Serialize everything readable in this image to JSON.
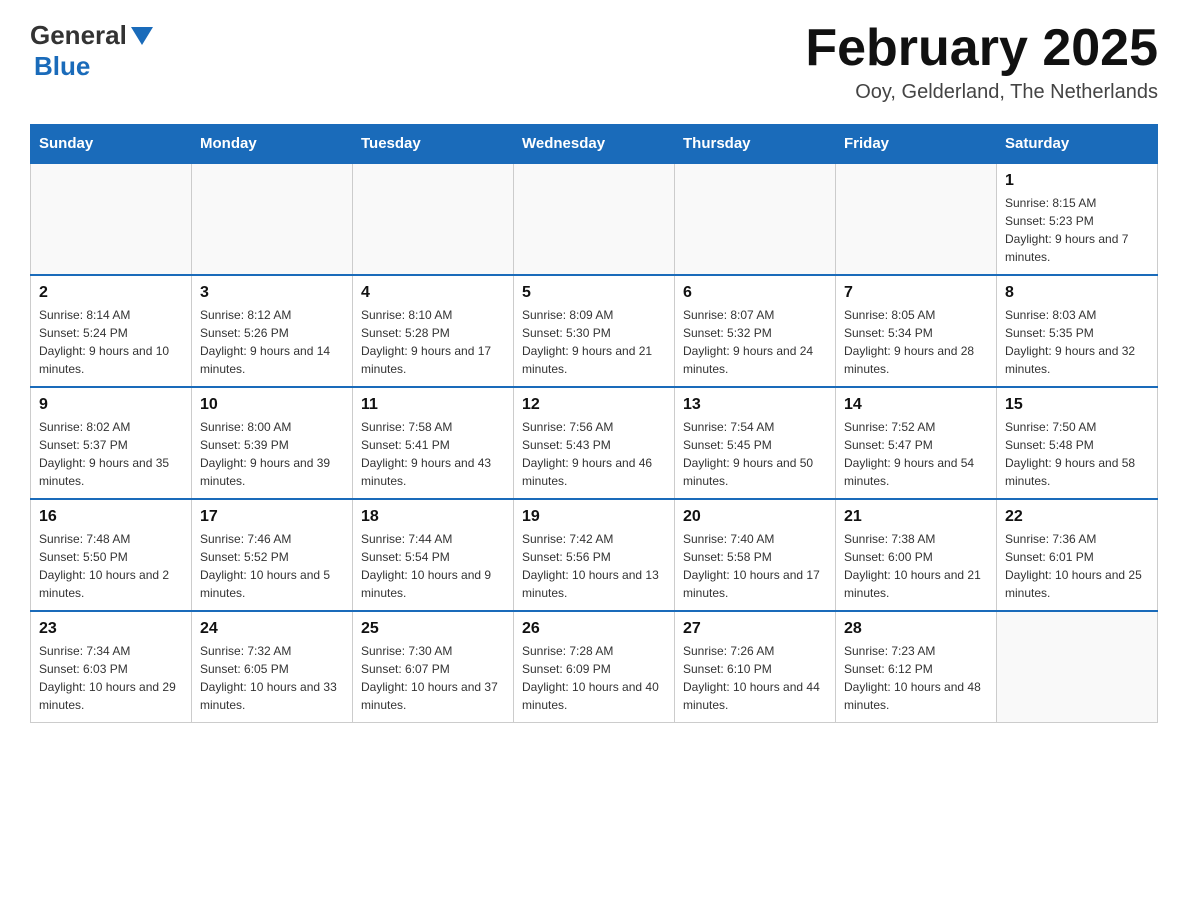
{
  "header": {
    "logo_general": "General",
    "logo_blue": "Blue",
    "title": "February 2025",
    "subtitle": "Ooy, Gelderland, The Netherlands"
  },
  "days_of_week": [
    "Sunday",
    "Monday",
    "Tuesday",
    "Wednesday",
    "Thursday",
    "Friday",
    "Saturday"
  ],
  "weeks": [
    [
      {
        "day": "",
        "info": ""
      },
      {
        "day": "",
        "info": ""
      },
      {
        "day": "",
        "info": ""
      },
      {
        "day": "",
        "info": ""
      },
      {
        "day": "",
        "info": ""
      },
      {
        "day": "",
        "info": ""
      },
      {
        "day": "1",
        "info": "Sunrise: 8:15 AM\nSunset: 5:23 PM\nDaylight: 9 hours and 7 minutes."
      }
    ],
    [
      {
        "day": "2",
        "info": "Sunrise: 8:14 AM\nSunset: 5:24 PM\nDaylight: 9 hours and 10 minutes."
      },
      {
        "day": "3",
        "info": "Sunrise: 8:12 AM\nSunset: 5:26 PM\nDaylight: 9 hours and 14 minutes."
      },
      {
        "day": "4",
        "info": "Sunrise: 8:10 AM\nSunset: 5:28 PM\nDaylight: 9 hours and 17 minutes."
      },
      {
        "day": "5",
        "info": "Sunrise: 8:09 AM\nSunset: 5:30 PM\nDaylight: 9 hours and 21 minutes."
      },
      {
        "day": "6",
        "info": "Sunrise: 8:07 AM\nSunset: 5:32 PM\nDaylight: 9 hours and 24 minutes."
      },
      {
        "day": "7",
        "info": "Sunrise: 8:05 AM\nSunset: 5:34 PM\nDaylight: 9 hours and 28 minutes."
      },
      {
        "day": "8",
        "info": "Sunrise: 8:03 AM\nSunset: 5:35 PM\nDaylight: 9 hours and 32 minutes."
      }
    ],
    [
      {
        "day": "9",
        "info": "Sunrise: 8:02 AM\nSunset: 5:37 PM\nDaylight: 9 hours and 35 minutes."
      },
      {
        "day": "10",
        "info": "Sunrise: 8:00 AM\nSunset: 5:39 PM\nDaylight: 9 hours and 39 minutes."
      },
      {
        "day": "11",
        "info": "Sunrise: 7:58 AM\nSunset: 5:41 PM\nDaylight: 9 hours and 43 minutes."
      },
      {
        "day": "12",
        "info": "Sunrise: 7:56 AM\nSunset: 5:43 PM\nDaylight: 9 hours and 46 minutes."
      },
      {
        "day": "13",
        "info": "Sunrise: 7:54 AM\nSunset: 5:45 PM\nDaylight: 9 hours and 50 minutes."
      },
      {
        "day": "14",
        "info": "Sunrise: 7:52 AM\nSunset: 5:47 PM\nDaylight: 9 hours and 54 minutes."
      },
      {
        "day": "15",
        "info": "Sunrise: 7:50 AM\nSunset: 5:48 PM\nDaylight: 9 hours and 58 minutes."
      }
    ],
    [
      {
        "day": "16",
        "info": "Sunrise: 7:48 AM\nSunset: 5:50 PM\nDaylight: 10 hours and 2 minutes."
      },
      {
        "day": "17",
        "info": "Sunrise: 7:46 AM\nSunset: 5:52 PM\nDaylight: 10 hours and 5 minutes."
      },
      {
        "day": "18",
        "info": "Sunrise: 7:44 AM\nSunset: 5:54 PM\nDaylight: 10 hours and 9 minutes."
      },
      {
        "day": "19",
        "info": "Sunrise: 7:42 AM\nSunset: 5:56 PM\nDaylight: 10 hours and 13 minutes."
      },
      {
        "day": "20",
        "info": "Sunrise: 7:40 AM\nSunset: 5:58 PM\nDaylight: 10 hours and 17 minutes."
      },
      {
        "day": "21",
        "info": "Sunrise: 7:38 AM\nSunset: 6:00 PM\nDaylight: 10 hours and 21 minutes."
      },
      {
        "day": "22",
        "info": "Sunrise: 7:36 AM\nSunset: 6:01 PM\nDaylight: 10 hours and 25 minutes."
      }
    ],
    [
      {
        "day": "23",
        "info": "Sunrise: 7:34 AM\nSunset: 6:03 PM\nDaylight: 10 hours and 29 minutes."
      },
      {
        "day": "24",
        "info": "Sunrise: 7:32 AM\nSunset: 6:05 PM\nDaylight: 10 hours and 33 minutes."
      },
      {
        "day": "25",
        "info": "Sunrise: 7:30 AM\nSunset: 6:07 PM\nDaylight: 10 hours and 37 minutes."
      },
      {
        "day": "26",
        "info": "Sunrise: 7:28 AM\nSunset: 6:09 PM\nDaylight: 10 hours and 40 minutes."
      },
      {
        "day": "27",
        "info": "Sunrise: 7:26 AM\nSunset: 6:10 PM\nDaylight: 10 hours and 44 minutes."
      },
      {
        "day": "28",
        "info": "Sunrise: 7:23 AM\nSunset: 6:12 PM\nDaylight: 10 hours and 48 minutes."
      },
      {
        "day": "",
        "info": ""
      }
    ]
  ]
}
